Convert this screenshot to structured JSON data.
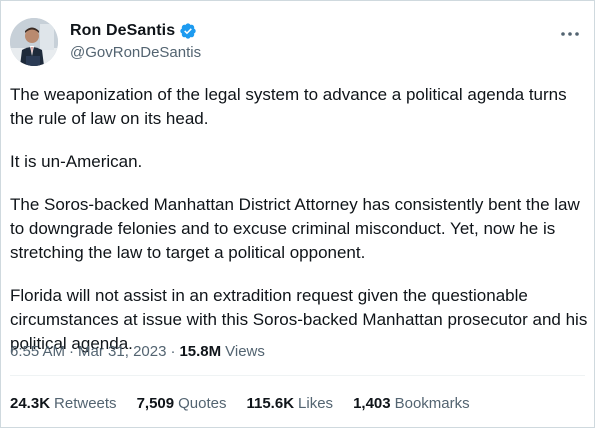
{
  "author": {
    "display_name": "Ron DeSantis",
    "handle": "@GovRonDeSantis",
    "verified": true,
    "verified_color": "#1d9bf0"
  },
  "tweet": {
    "paragraphs": [
      "The weaponization of the legal system to advance a political agenda turns the rule of law on its head.",
      "It is un-American.",
      "The Soros-backed Manhattan District Attorney has consistently bent the law to downgrade felonies and to excuse criminal misconduct. Yet, now he is stretching the law to target a political opponent.",
      "Florida will not assist in an extradition request given the questionable circumstances at issue with this Soros-backed Manhattan prosecutor and his political agenda."
    ]
  },
  "meta": {
    "time": "6:55 AM",
    "separator": "·",
    "date": "Mar 31, 2023",
    "views_count": "15.8M",
    "views_label": "Views"
  },
  "stats": {
    "retweets": {
      "count": "24.3K",
      "label": "Retweets"
    },
    "quotes": {
      "count": "7,509",
      "label": "Quotes"
    },
    "likes": {
      "count": "115.6K",
      "label": "Likes"
    },
    "bookmarks": {
      "count": "1,403",
      "label": "Bookmarks"
    }
  },
  "icons": {
    "verified": "verified-badge-icon",
    "more": "more-options-icon"
  },
  "colors": {
    "text_primary": "#0f1419",
    "text_secondary": "#536471",
    "border": "#cfd9de"
  }
}
